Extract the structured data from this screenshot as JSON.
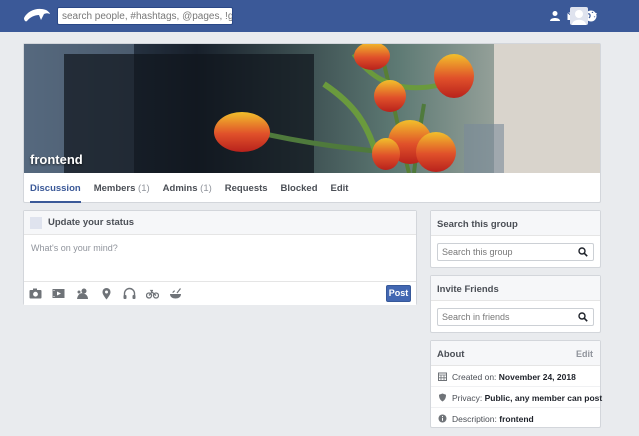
{
  "topbar": {
    "search_placeholder": "search people, #hashtags, @pages, !groups",
    "icons": [
      "friend-requests-icon",
      "messages-icon",
      "notifications-globe-icon"
    ]
  },
  "group": {
    "name": "frontend",
    "tabs": [
      {
        "label": "Discussion",
        "count": ""
      },
      {
        "label": "Members",
        "count": "(1)"
      },
      {
        "label": "Admins",
        "count": "(1)"
      },
      {
        "label": "Requests",
        "count": ""
      },
      {
        "label": "Blocked",
        "count": ""
      },
      {
        "label": "Edit",
        "count": ""
      }
    ]
  },
  "composer": {
    "title": "Update your status",
    "placeholder": "What's on your mind?",
    "post_label": "Post",
    "tools": [
      "photo-icon",
      "video-icon",
      "feeling-icon",
      "location-icon",
      "music-icon",
      "activity-icon",
      "food-icon"
    ]
  },
  "search_group": {
    "title": "Search this group",
    "placeholder": "Search this group"
  },
  "invite": {
    "title": "Invite Friends",
    "placeholder": "Search in friends"
  },
  "about": {
    "title": "About",
    "edit_label": "Edit",
    "created_label": "Created on:",
    "created_value": "November 24, 2018",
    "privacy_label": "Privacy:",
    "privacy_value": "Public, any member can post",
    "description_label": "Description:",
    "description_value": "frontend"
  },
  "colors": {
    "brand": "#3b5998",
    "button": "#4267b2",
    "background": "#e9ebee"
  }
}
